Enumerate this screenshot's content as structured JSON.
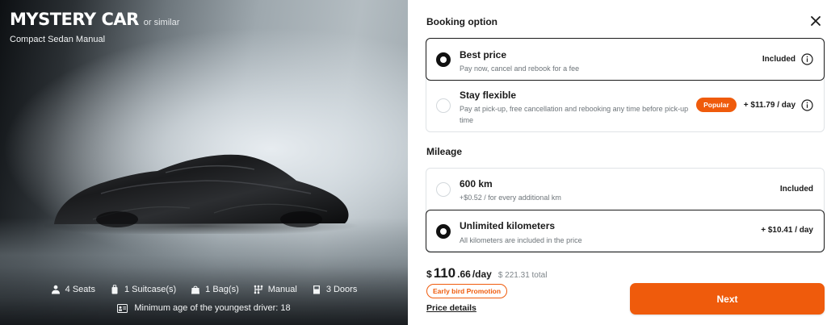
{
  "hero": {
    "title": "MYSTERY CAR",
    "title_suffix": "or similar",
    "subtitle": "Compact Sedan Manual",
    "specs": [
      {
        "icon": "person-icon",
        "label": "4 Seats"
      },
      {
        "icon": "suitcase-icon",
        "label": "1 Suitcase(s)"
      },
      {
        "icon": "bag-icon",
        "label": "1 Bag(s)"
      },
      {
        "icon": "gearshift-icon",
        "label": "Manual"
      },
      {
        "icon": "door-icon",
        "label": "3 Doors"
      }
    ],
    "min_age": "Minimum age of the youngest driver: 18"
  },
  "booking": {
    "title": "Booking option",
    "options": [
      {
        "title": "Best price",
        "desc": "Pay now, cancel and rebook for a fee",
        "right": "Included",
        "selected": true
      },
      {
        "title": "Stay flexible",
        "desc": "Pay at pick-up, free cancellation and rebooking any time before pick-up time",
        "badge": "Popular",
        "right": "+ $11.79 / day",
        "selected": false
      }
    ]
  },
  "mileage": {
    "title": "Mileage",
    "options": [
      {
        "title": "600 km",
        "desc": "+$0.52 / for every additional km",
        "right": "Included",
        "selected": false
      },
      {
        "title": "Unlimited kilometers",
        "desc": "All kilometers are included in the price",
        "right": "+ $10.41 / day",
        "selected": true
      }
    ]
  },
  "price": {
    "currency": "$",
    "integer": "110",
    "decimal": ".66",
    "per": "/day",
    "total": "$ 221.31 total",
    "promo": "Early bird Promotion",
    "details": "Price details"
  },
  "next_label": "Next",
  "colors": {
    "accent": "#ef5b0c",
    "selected_border": "#1a1a1a"
  }
}
